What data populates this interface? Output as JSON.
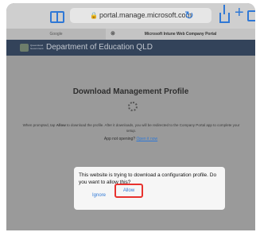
{
  "browser": {
    "url": "portal.manage.microsoft.com",
    "tabs": [
      {
        "label": "Google"
      },
      {
        "label": "Microsoft Intune Web Company Portal"
      }
    ]
  },
  "banner": {
    "org_small": "Queensland Government",
    "title": "Department of Education QLD"
  },
  "main": {
    "title": "Download Management Profile",
    "instruction_before": "When prompted, tap",
    "instruction_bold": "Allow",
    "instruction_after": "to download the profile. After it downloads, you will be redirected to the Company Portal app to complete your setup.",
    "help_prefix": "App not opening?",
    "help_link": "Open it now"
  },
  "dialog": {
    "message": "This website is trying to download a configuration profile. Do you want to allow this?",
    "ignore_label": "Ignore",
    "allow_label": "Allow"
  },
  "colors": {
    "accent": "#2f78d6",
    "highlight": "#e8322e",
    "banner": "#33435a"
  }
}
